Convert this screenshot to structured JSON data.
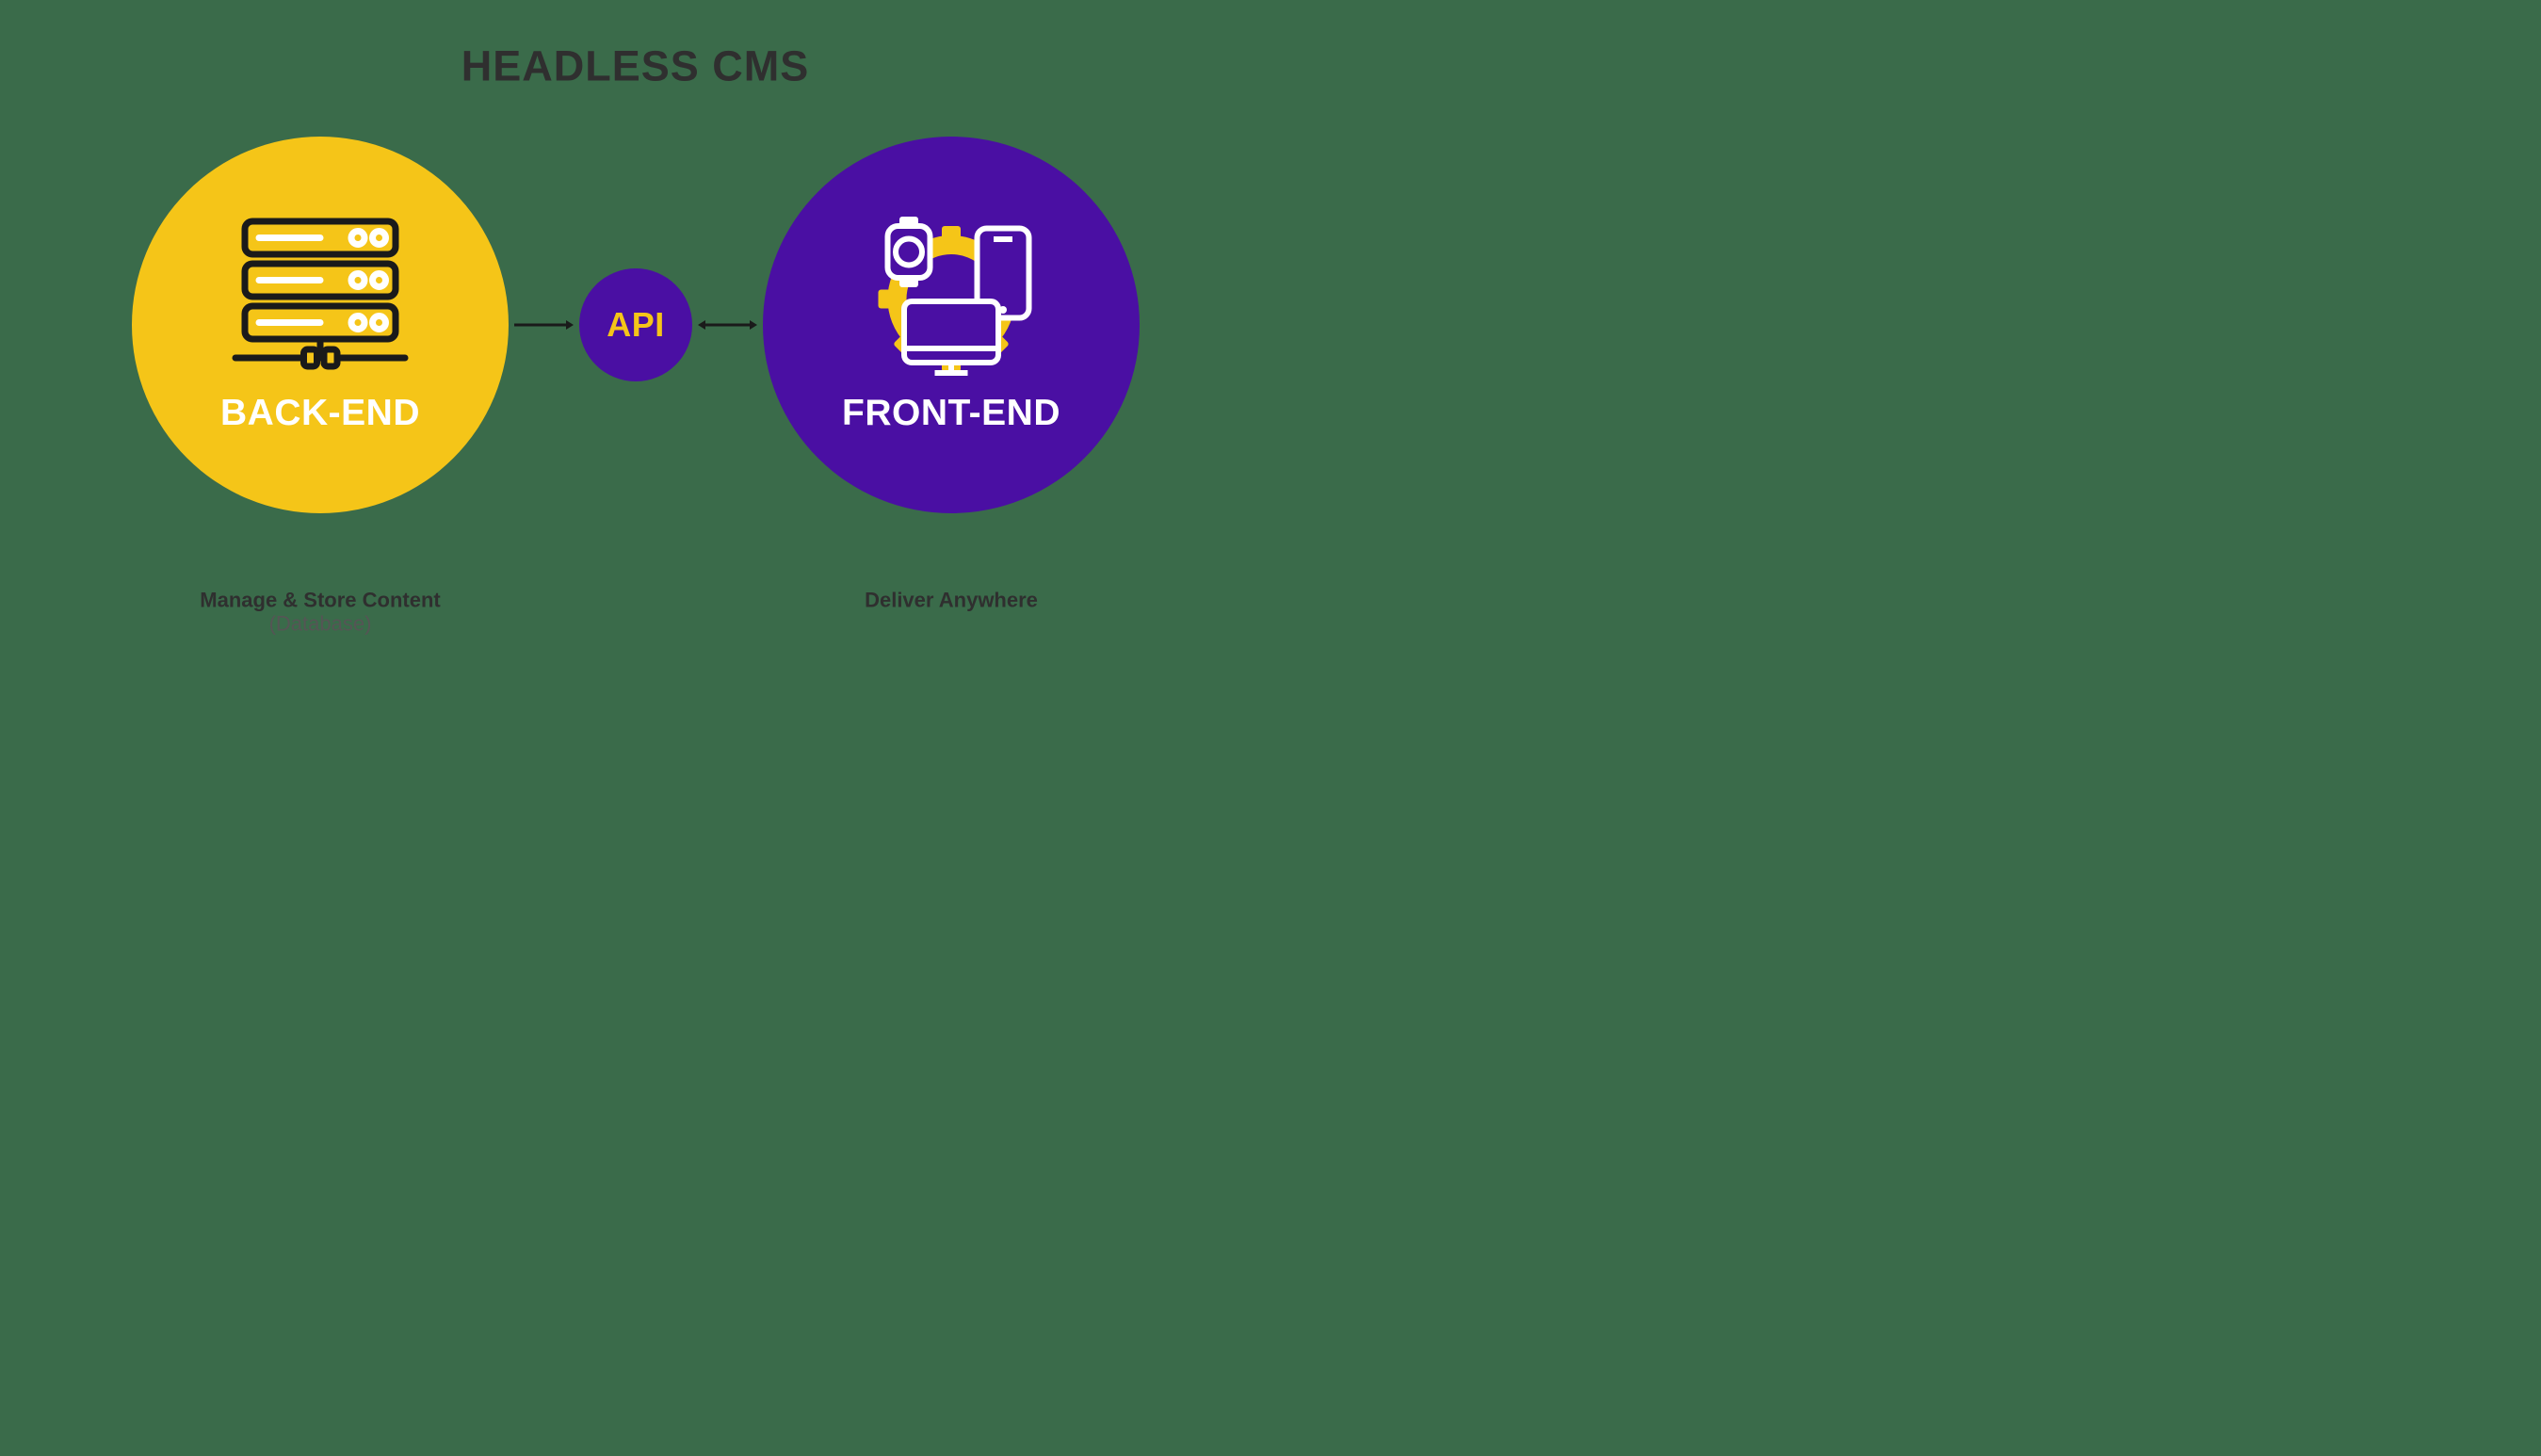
{
  "title": "HEADLESS CMS",
  "backend": {
    "label": "BACK-END",
    "caption_line1": "Manage & Store Content",
    "caption_line2": "(Database)",
    "icon": "server-stack-icon"
  },
  "api": {
    "label": "API"
  },
  "frontend": {
    "label": "FRONT-END",
    "caption_line1": "Deliver Anywhere",
    "caption_line2": "",
    "icon": "devices-gear-icon"
  },
  "colors": {
    "background": "#3a6b4a",
    "yellow": "#f5c518",
    "purple": "#4a0fa3",
    "dark": "#2f2f2f",
    "white": "#ffffff"
  },
  "arrows": {
    "left": "single-right",
    "right": "double-headed"
  }
}
